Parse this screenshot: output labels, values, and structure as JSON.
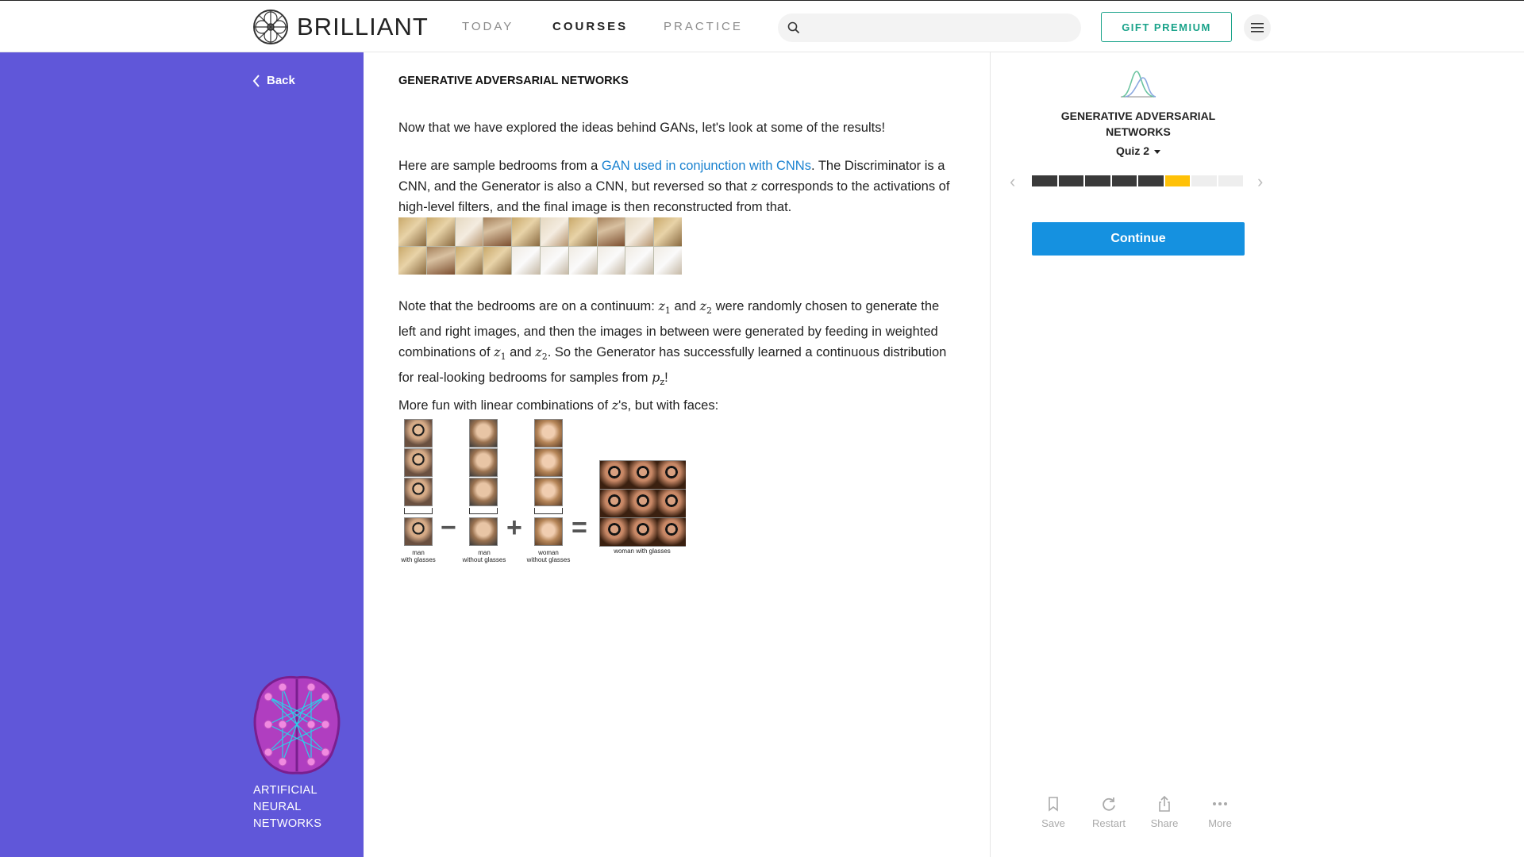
{
  "nav": {
    "brand": "BRILLIANT",
    "links": [
      "TODAY",
      "COURSES",
      "PRACTICE"
    ],
    "active": "COURSES",
    "search_placeholder": "",
    "gift_label": "GIFT PREMIUM",
    "icons": {
      "logo": "brilliant-logo-icon",
      "search": "search-icon",
      "menu": "hamburger-menu-icon"
    }
  },
  "sidebar": {
    "back_label": "Back",
    "course_line1": "ARTIFICIAL",
    "course_line2": "NEURAL",
    "course_line3": "NETWORKS",
    "background": "#6057d9"
  },
  "main": {
    "section_title": "GENERATIVE ADVERSARIAL NETWORKS",
    "p1": "Now that we have explored the ideas behind GANs, let's look at some of the results!",
    "p2_pre": "Here are sample bedrooms from a ",
    "p2_link": "GAN used in conjunction with CNNs",
    "p2_mid": ". The Discriminator is a CNN, and the Generator is also a CNN, but reversed so that ",
    "p2_var": "z",
    "p2_post": " corresponds to the activations of high-level filters, and the final image is then reconstructed from that.",
    "p3_a": "Note that the bedrooms are on a continuum: ",
    "p3_b": " and ",
    "p3_c": " were randomly chosen to generate the left and right images, and then the images in between were generated by feeding in weighted combinations of ",
    "p3_d": " and ",
    "p3_e": ". So the Generator has successfully learned a continuous distribution for real-looking bedrooms for samples from ",
    "p3_f": "!",
    "var_z": "z",
    "sub_1": "1",
    "sub_2": "2",
    "var_p": "p",
    "sub_z": "z",
    "p4_pre": "More fun with linear combinations of ",
    "p4_var": "z",
    "p4_post": "'s, but with faces:",
    "faces_captions": {
      "c1a": "man",
      "c1b": "with glasses",
      "c2a": "man",
      "c2b": "without glasses",
      "c3a": "woman",
      "c3b": "without glasses",
      "c4": "woman with glasses"
    },
    "ops": {
      "minus": "−",
      "plus": "+",
      "equals": "="
    }
  },
  "panel": {
    "title_line1": "GENERATIVE ADVERSARIAL",
    "title_line2": "NETWORKS",
    "quiz_label": "Quiz 2",
    "progress": {
      "total": 8,
      "completed": 5,
      "current": 6
    },
    "continue_label": "Continue",
    "continue_color": "#1591e0",
    "actions": [
      {
        "label": "Save",
        "icon": "bookmark-icon"
      },
      {
        "label": "Restart",
        "icon": "restart-icon"
      },
      {
        "label": "Share",
        "icon": "share-icon"
      },
      {
        "label": "More",
        "icon": "more-dots-icon"
      }
    ]
  }
}
